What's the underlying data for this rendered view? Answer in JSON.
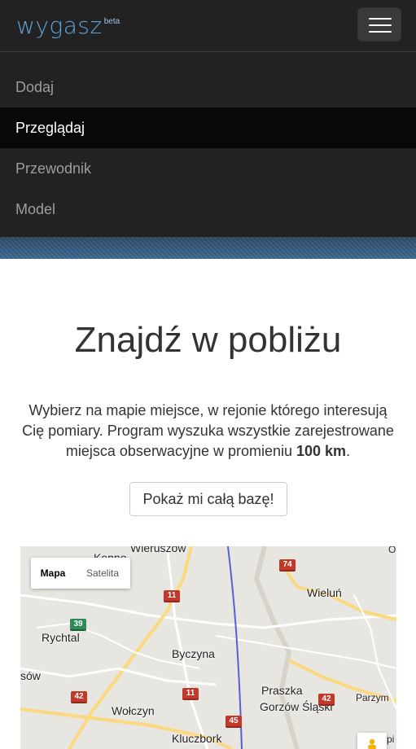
{
  "header": {
    "brand": "wygasz",
    "brand_badge": "beta",
    "menu_toggle_icon": "hamburger-icon"
  },
  "menu": {
    "items": [
      {
        "label": "Dodaj",
        "active": false
      },
      {
        "label": "Przeglądaj",
        "active": true
      },
      {
        "label": "Przewodnik",
        "active": false
      },
      {
        "label": "Model",
        "active": false
      }
    ]
  },
  "main": {
    "title": "Znajdź w pobliżu",
    "description_before": "Wybierz na mapie miejsce, w rejonie którego interesują Cię pomiary. Program wyszuka wszystkie zarejestrowane miejsca obserwacyjne w promieniu ",
    "description_bold": "100 km",
    "description_after": ".",
    "show_all_button": "Pokaż mi całą bazę!"
  },
  "map": {
    "type_controls": {
      "map": "Mapa",
      "satellite": "Satelita",
      "selected": "Mapa"
    },
    "pegman_icon": "pegman-icon",
    "places": [
      "Wieruszów",
      "Kępno",
      "Rychtal",
      "Byczyna",
      "Wieluń",
      "Praszka",
      "Gorzów Śląski",
      "Wołczyn",
      "Kluczbork",
      "Parzym",
      "sów",
      "O",
      "pi"
    ],
    "road_shields": [
      "74",
      "11",
      "39",
      "11",
      "42",
      "42",
      "45"
    ],
    "colors": {
      "land": "#e8e6e1",
      "road_major": "#fcd87f",
      "road_minor": "#ffffff",
      "border": "#5560d8"
    }
  },
  "colors": {
    "navbar_bg": "#222222",
    "menu_active_bg": "#080808",
    "brand": "#5ba3d8"
  }
}
